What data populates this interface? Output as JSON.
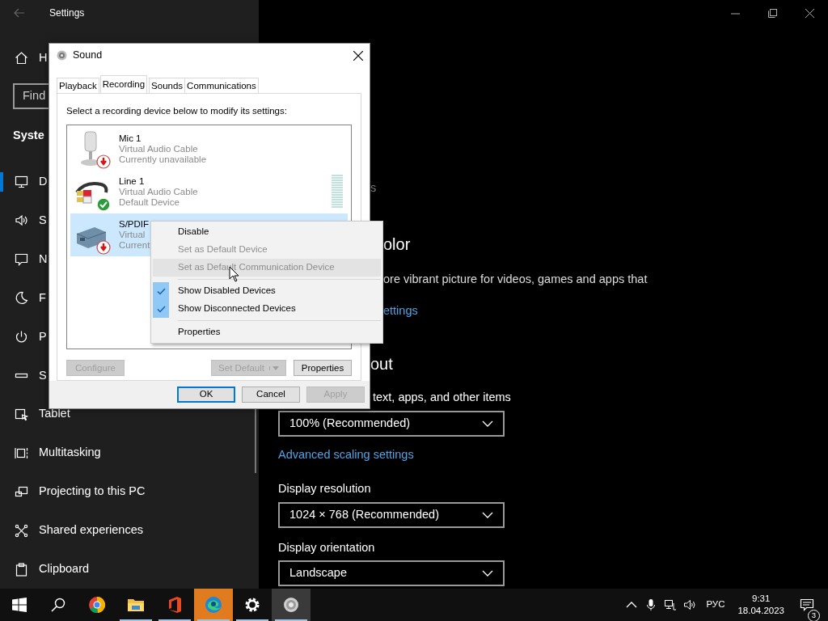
{
  "settings_window": {
    "title": "Settings",
    "sidebar": {
      "home": "H",
      "search_placeholder": "Find",
      "section": "Syste",
      "items": [
        {
          "label": "D",
          "selected": true
        },
        {
          "label": "S",
          "selected": false
        },
        {
          "label": "N",
          "selected": false
        },
        {
          "label": "F",
          "selected": false
        },
        {
          "label": "P",
          "selected": false
        },
        {
          "label": "S",
          "selected": false
        },
        {
          "label": "Tablet",
          "selected": false
        },
        {
          "label": "Multitasking",
          "selected": false
        },
        {
          "label": "Projecting to this PC",
          "selected": false
        },
        {
          "label": "Shared experiences",
          "selected": false
        },
        {
          "label": "Clipboard",
          "selected": false
        }
      ]
    },
    "content": {
      "line_fragment": "s",
      "color_heading": "olor",
      "color_description": "ore vibrant picture for videos, games and apps that",
      "color_link": "ettings",
      "layout_heading": "out",
      "scale_label": "text, apps, and other items",
      "scale_dropdown": "100% (Recommended)",
      "advanced_link": "Advanced scaling settings",
      "resolution_label": "Display resolution",
      "resolution_dropdown": "1024 × 768 (Recommended)",
      "orientation_label": "Display orientation",
      "orientation_dropdown": "Landscape"
    }
  },
  "sound_dialog": {
    "title": "Sound",
    "tabs": [
      {
        "label": "Playback",
        "selected": false
      },
      {
        "label": "Recording",
        "selected": true
      },
      {
        "label": "Sounds",
        "selected": false
      },
      {
        "label": "Communications",
        "selected": false
      }
    ],
    "instruction": "Select a recording device below to modify its settings:",
    "devices": [
      {
        "name": "Mic 1",
        "driver": "Virtual Audio Cable",
        "status": "Currently unavailable",
        "default_device": false,
        "selected": false
      },
      {
        "name": "Line 1",
        "driver": "Virtual Audio Cable",
        "status": "Default Device",
        "default_device": true,
        "selected": false,
        "level": 0
      },
      {
        "name": "S/PDIF",
        "driver": "Virtual",
        "status": "Current",
        "default_device": false,
        "selected": true
      }
    ],
    "buttons": [
      {
        "label": "Configure",
        "disabled": true,
        "kind": "plain"
      },
      {
        "label": "Set Default",
        "disabled": true,
        "kind": "split"
      },
      {
        "label": "Properties",
        "disabled": false,
        "kind": "plain"
      }
    ],
    "footer_buttons": [
      {
        "label": "OK",
        "disabled": false,
        "default": true
      },
      {
        "label": "Cancel",
        "disabled": false,
        "default": false
      },
      {
        "label": "Apply",
        "disabled": true,
        "default": false
      }
    ]
  },
  "context_menu": {
    "items": [
      {
        "kind": "item",
        "label": "Disable",
        "disabled": false,
        "checked": false,
        "highlighted": false
      },
      {
        "kind": "item",
        "label": "Set as Default Device",
        "disabled": true,
        "checked": false,
        "highlighted": false
      },
      {
        "kind": "item",
        "label": "Set as Default Communication Device",
        "disabled": true,
        "checked": false,
        "highlighted": true
      },
      {
        "kind": "separator"
      },
      {
        "kind": "item",
        "label": "Show Disabled Devices",
        "disabled": false,
        "checked": true,
        "highlighted": false
      },
      {
        "kind": "item",
        "label": "Show Disconnected Devices",
        "disabled": false,
        "checked": true,
        "highlighted": false
      },
      {
        "kind": "separator"
      },
      {
        "kind": "item",
        "label": "Properties",
        "disabled": false,
        "checked": false,
        "highlighted": false
      }
    ]
  },
  "taskbar": {
    "apps": [
      {
        "running": false,
        "flashing": false,
        "focused": false
      },
      {
        "running": true,
        "flashing": false,
        "focused": false
      },
      {
        "running": true,
        "flashing": false,
        "focused": false
      },
      {
        "running": true,
        "flashing": true,
        "focused": false
      },
      {
        "running": true,
        "flashing": false,
        "focused": false
      },
      {
        "running": true,
        "flashing": false,
        "focused": true
      }
    ],
    "language": "РУС",
    "time": "9:31",
    "date": "18.04.2023",
    "notification_count": "3"
  }
}
